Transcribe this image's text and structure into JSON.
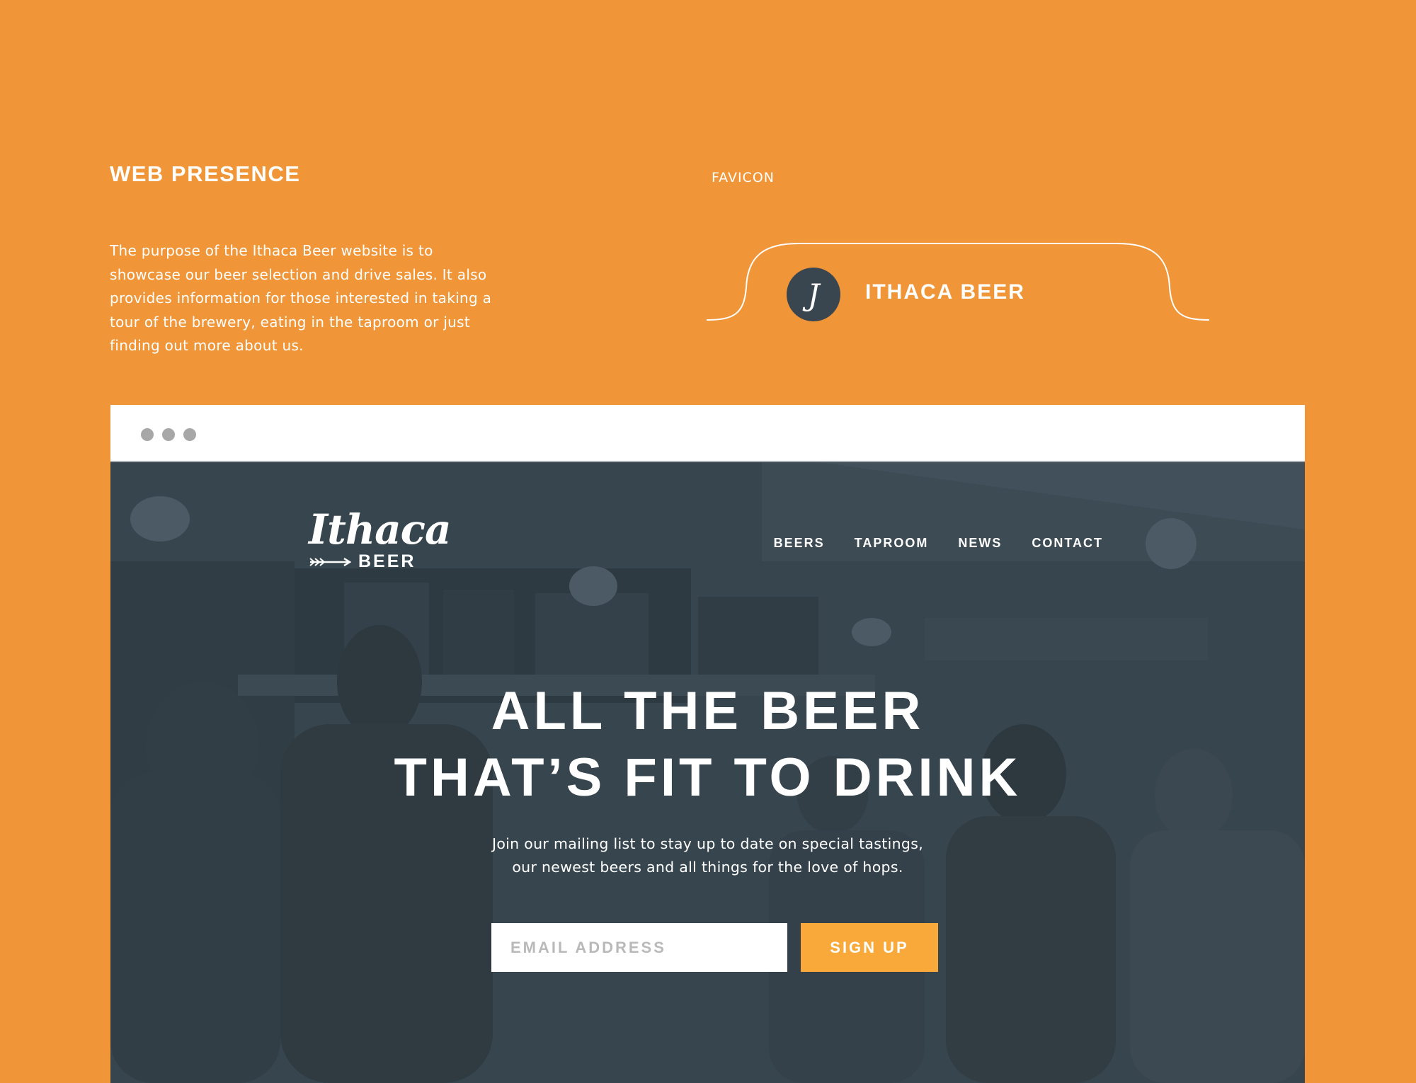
{
  "section": {
    "title": "WEB PRESENCE",
    "description": "The purpose of the Ithaca Beer website is to showcase our beer selection and drive sales. It also provides information for those interested in taking a tour of the brewery, eating in the taproom or just finding out more about us."
  },
  "favicon": {
    "label": "FAVICON",
    "icon_letter": "J",
    "tab_title": "ITHACA BEER"
  },
  "site": {
    "logo": {
      "script": "Ithaca",
      "sub": "BEER"
    },
    "nav": [
      "BEERS",
      "TAPROOM",
      "NEWS",
      "CONTACT"
    ],
    "hero": {
      "line1": "ALL THE BEER",
      "line2": "THAT’S FIT TO DRINK",
      "sub_line1": "Join our mailing list to stay up to date on special tastings,",
      "sub_line2": "our newest beers and all things for the love of hops."
    },
    "signup": {
      "placeholder": "EMAIL ADDRESS",
      "button": "SIGN UP"
    }
  },
  "colors": {
    "background": "#f09638",
    "hero_overlay": "#36444d",
    "favicon_bg": "#3a464f",
    "button": "#f9a93a"
  }
}
